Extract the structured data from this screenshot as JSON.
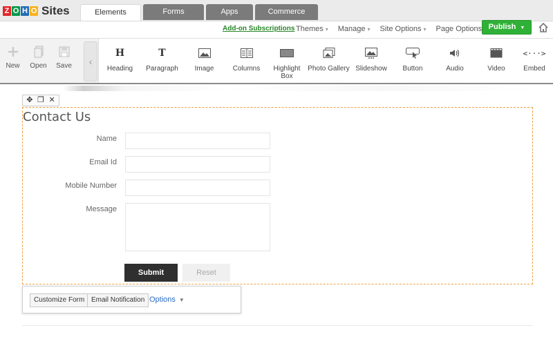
{
  "app": {
    "logo_letters": [
      "Z",
      "O",
      "H",
      "O"
    ],
    "logo_colors": [
      "#e42527",
      "#089949",
      "#226db4",
      "#f9b21d"
    ],
    "product_name": "Sites"
  },
  "tabs": [
    {
      "label": "Elements",
      "active": true
    },
    {
      "label": "Forms",
      "active": false
    },
    {
      "label": "Apps",
      "active": false
    },
    {
      "label": "Commerce",
      "active": false
    }
  ],
  "menubar": {
    "addon_link": "Add-on Subscriptions",
    "menus": [
      "Themes",
      "Manage",
      "Site Options",
      "Page Options"
    ],
    "publish_label": "Publish",
    "publish_color": "#2fb137"
  },
  "file_ops": [
    {
      "label": "New",
      "icon": "plus-icon"
    },
    {
      "label": "Open",
      "icon": "document-icon"
    },
    {
      "label": "Save",
      "icon": "floppy-icon"
    }
  ],
  "elements": [
    {
      "label": "Heading",
      "icon": "heading-icon",
      "glyph": "H"
    },
    {
      "label": "Paragraph",
      "icon": "paragraph-icon",
      "glyph": "T"
    },
    {
      "label": "Image",
      "icon": "image-icon",
      "glyph": ""
    },
    {
      "label": "Columns",
      "icon": "columns-icon",
      "glyph": ""
    },
    {
      "label": "Highlight Box",
      "icon": "highlight-box-icon",
      "glyph": ""
    },
    {
      "label": "Photo Gallery",
      "icon": "photo-gallery-icon",
      "glyph": ""
    },
    {
      "label": "Slideshow",
      "icon": "slideshow-icon",
      "glyph": ""
    },
    {
      "label": "Button",
      "icon": "button-icon",
      "glyph": ""
    },
    {
      "label": "Audio",
      "icon": "audio-icon",
      "glyph": ""
    },
    {
      "label": "Video",
      "icon": "video-icon",
      "glyph": ""
    },
    {
      "label": "Embed",
      "icon": "embed-icon",
      "glyph": "<···>"
    }
  ],
  "form": {
    "title": "Contact Us",
    "fields": [
      {
        "label": "Name",
        "value": ""
      },
      {
        "label": "Email Id",
        "value": ""
      },
      {
        "label": "Mobile Number",
        "value": ""
      },
      {
        "label": "Message",
        "value": ""
      }
    ],
    "submit_label": "Submit",
    "reset_label": "Reset"
  },
  "form_options": {
    "customize_label": "Customize Form",
    "email_label": "Email Notification",
    "options_label": "Options"
  }
}
